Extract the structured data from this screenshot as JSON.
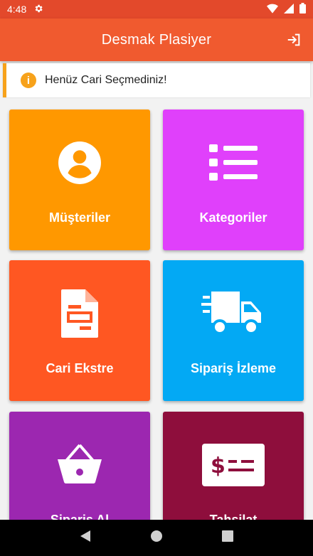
{
  "status_bar": {
    "time": "4:48"
  },
  "app_bar": {
    "title": "Desmak Plasiyer"
  },
  "notice": {
    "message": "Henüz Cari Seçmediniz!"
  },
  "tiles": [
    {
      "label": "Müşteriler",
      "color": "#ff9800",
      "icon": "account-circle-icon"
    },
    {
      "label": "Kategoriler",
      "color": "#e040fb",
      "icon": "list-icon"
    },
    {
      "label": "Cari Ekstre",
      "color": "#ff5722",
      "icon": "document-icon"
    },
    {
      "label": "Sipariş İzleme",
      "color": "#03a9f4",
      "icon": "truck-icon"
    },
    {
      "label": "Sipariş Al",
      "color": "#9c27b0",
      "icon": "basket-icon"
    },
    {
      "label": "Tahsilat",
      "color": "#8e0e3c",
      "icon": "money-bill-icon"
    }
  ],
  "colors": {
    "status_bar": "#e3492b",
    "app_bar": "#f05a2f",
    "notice_accent": "#f7a21b"
  }
}
